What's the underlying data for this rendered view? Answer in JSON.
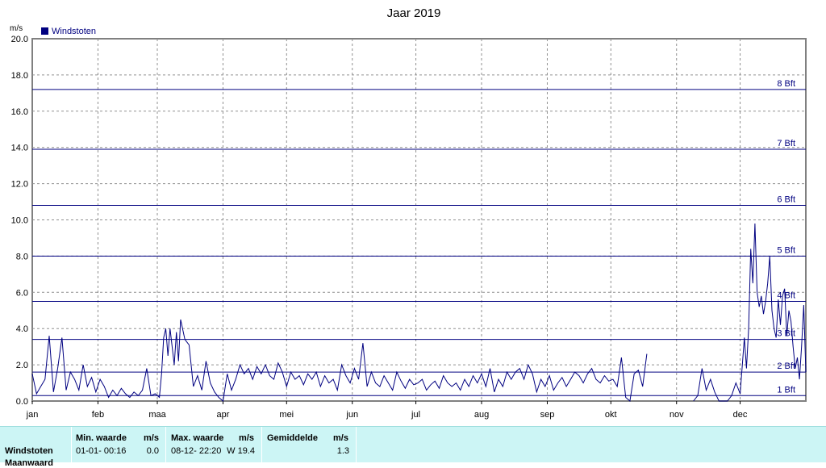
{
  "chart_data": {
    "type": "line",
    "title": "Jaar 2019",
    "ylabel": "m/s",
    "ylim": [
      0,
      20
    ],
    "yticks": [
      "0.0",
      "2.0",
      "4.0",
      "6.0",
      "8.0",
      "10.0",
      "12.0",
      "14.0",
      "16.0",
      "18.0",
      "20.0"
    ],
    "xlim": [
      0,
      365
    ],
    "months": [
      {
        "label": "jan",
        "day": 0
      },
      {
        "label": "feb",
        "day": 31
      },
      {
        "label": "maa",
        "day": 59
      },
      {
        "label": "apr",
        "day": 90
      },
      {
        "label": "mei",
        "day": 120
      },
      {
        "label": "jun",
        "day": 151
      },
      {
        "label": "jul",
        "day": 181
      },
      {
        "label": "aug",
        "day": 212
      },
      {
        "label": "sep",
        "day": 243
      },
      {
        "label": "okt",
        "day": 273
      },
      {
        "label": "nov",
        "day": 304
      },
      {
        "label": "dec",
        "day": 334
      }
    ],
    "grid": true,
    "legend_position": "top-left",
    "series": [
      {
        "name": "Windstoten",
        "color": "#000080",
        "segments": [
          {
            "x": [
              0,
              2,
              4,
              6,
              8,
              10,
              12,
              14,
              16,
              18,
              20,
              22,
              24,
              26,
              28,
              30,
              32,
              34,
              36,
              38,
              40,
              42,
              44,
              46,
              48,
              50,
              52,
              54,
              56,
              58,
              60,
              61,
              62,
              63,
              64,
              65,
              66,
              67,
              68,
              69,
              70,
              72,
              74,
              76,
              78,
              80,
              82,
              84,
              86,
              88,
              90,
              92,
              94,
              96,
              98,
              100,
              102,
              104,
              106,
              108,
              110,
              112,
              114,
              116,
              118,
              120,
              122,
              124,
              126,
              128,
              130,
              132,
              134,
              136,
              138,
              140,
              142,
              144,
              146,
              148,
              150,
              152,
              154,
              156,
              158,
              160,
              162,
              164,
              166,
              168,
              170,
              172,
              174,
              176,
              178,
              180,
              182,
              184,
              186,
              188,
              190,
              192,
              194,
              196,
              198,
              200,
              202,
              204,
              206,
              208,
              210,
              212,
              214,
              216,
              218,
              220,
              222,
              224,
              226,
              228,
              230,
              232,
              234,
              236,
              238,
              240,
              242,
              244,
              246,
              248,
              250,
              252,
              254,
              256,
              258,
              260,
              262,
              264,
              266,
              268,
              270,
              272,
              274,
              276,
              278,
              280,
              282,
              284,
              286,
              288,
              290
            ],
            "y": [
              1.5,
              0.4,
              0.8,
              1.2,
              3.6,
              0.5,
              1.8,
              3.5,
              0.6,
              1.6,
              1.2,
              0.6,
              2.0,
              0.8,
              1.3,
              0.5,
              1.2,
              0.8,
              0.2,
              0.6,
              0.3,
              0.7,
              0.4,
              0.2,
              0.5,
              0.3,
              0.6,
              1.8,
              0.3,
              0.4,
              0.2,
              1.5,
              3.5,
              4.0,
              2.5,
              4.0,
              3.0,
              2.0,
              3.8,
              2.2,
              4.5,
              3.4,
              3.1,
              0.8,
              1.4,
              0.6,
              2.2,
              1.0,
              0.5,
              0.2,
              0.0,
              1.5,
              0.6,
              1.2,
              2.0,
              1.5,
              1.8,
              1.2,
              1.9,
              1.5,
              2.0,
              1.4,
              1.2,
              2.1,
              1.6,
              0.8,
              1.6,
              1.2,
              1.4,
              0.9,
              1.5,
              1.2,
              1.6,
              0.8,
              1.4,
              1.0,
              1.2,
              0.6,
              2.0,
              1.4,
              1.0,
              1.8,
              1.2,
              3.2,
              0.8,
              1.6,
              1.0,
              0.8,
              1.4,
              1.0,
              0.6,
              1.6,
              1.1,
              0.7,
              1.2,
              0.9,
              1.0,
              1.2,
              0.6,
              0.9,
              1.1,
              0.7,
              1.4,
              1.0,
              0.8,
              1.0,
              0.6,
              1.2,
              0.8,
              1.4,
              1.0,
              1.5,
              0.8,
              1.8,
              0.5,
              1.2,
              0.8,
              1.6,
              1.2,
              1.6,
              1.8,
              1.2,
              2.0,
              1.5,
              0.5,
              1.2,
              0.8,
              1.4,
              0.6,
              1.0,
              1.3,
              0.8,
              1.2,
              1.6,
              1.4,
              1.0,
              1.5,
              1.8,
              1.2,
              1.0,
              1.4,
              1.1,
              1.2,
              0.8,
              2.4,
              0.2,
              0.0,
              1.5,
              1.7,
              0.8,
              2.6,
              1.0,
              0.2,
              0.3,
              0.0
            ]
          },
          {
            "x": [
              312,
              314,
              316,
              318,
              320,
              322,
              324,
              326,
              328,
              330,
              332,
              334,
              336,
              337,
              338,
              339,
              340,
              341,
              342,
              343,
              344,
              345,
              346,
              347,
              348,
              349,
              350,
              351,
              352,
              353,
              354,
              355,
              356,
              357,
              358,
              359,
              360,
              361,
              362,
              363,
              364,
              365
            ],
            "y": [
              0.0,
              0.3,
              1.8,
              0.6,
              1.2,
              0.5,
              0.0,
              0.0,
              0.0,
              0.3,
              1.0,
              0.4,
              3.5,
              1.8,
              4.0,
              8.4,
              6.5,
              9.8,
              6.0,
              5.2,
              5.8,
              4.8,
              5.5,
              6.5,
              8.0,
              5.0,
              4.0,
              3.5,
              5.6,
              4.2,
              5.8,
              6.2,
              3.6,
              5.0,
              4.4,
              3.0,
              1.8,
              2.4,
              1.2,
              3.0,
              5.3,
              1.6
            ]
          }
        ]
      }
    ],
    "reference_lines": [
      {
        "label": "1 Bft",
        "value": 0.3
      },
      {
        "label": "2 Bft",
        "value": 1.6
      },
      {
        "label": "3 Bft",
        "value": 3.4
      },
      {
        "label": "4 Bft",
        "value": 5.5
      },
      {
        "label": "5 Bft",
        "value": 8.0
      },
      {
        "label": "6 Bft",
        "value": 10.8
      },
      {
        "label": "7 Bft",
        "value": 13.9
      },
      {
        "label": "8 Bft",
        "value": 17.2
      }
    ]
  },
  "stats": {
    "row_label": "Windstoten",
    "row_label_2": "Maanwaard",
    "min": {
      "header": "Min. waarde",
      "unit": "m/s",
      "time": "01-01- 00:16",
      "value": "0.0"
    },
    "max": {
      "header": "Max. waarde",
      "unit": "m/s",
      "time": "08-12- 22:20",
      "value": "W 19.4"
    },
    "avg": {
      "header": "Gemiddelde",
      "unit": "m/s",
      "value": "1.3"
    }
  },
  "colors": {
    "series": "#000080",
    "panel_bg": "#ccf5f5",
    "plot_border": "#808080",
    "grid": "#808080"
  }
}
